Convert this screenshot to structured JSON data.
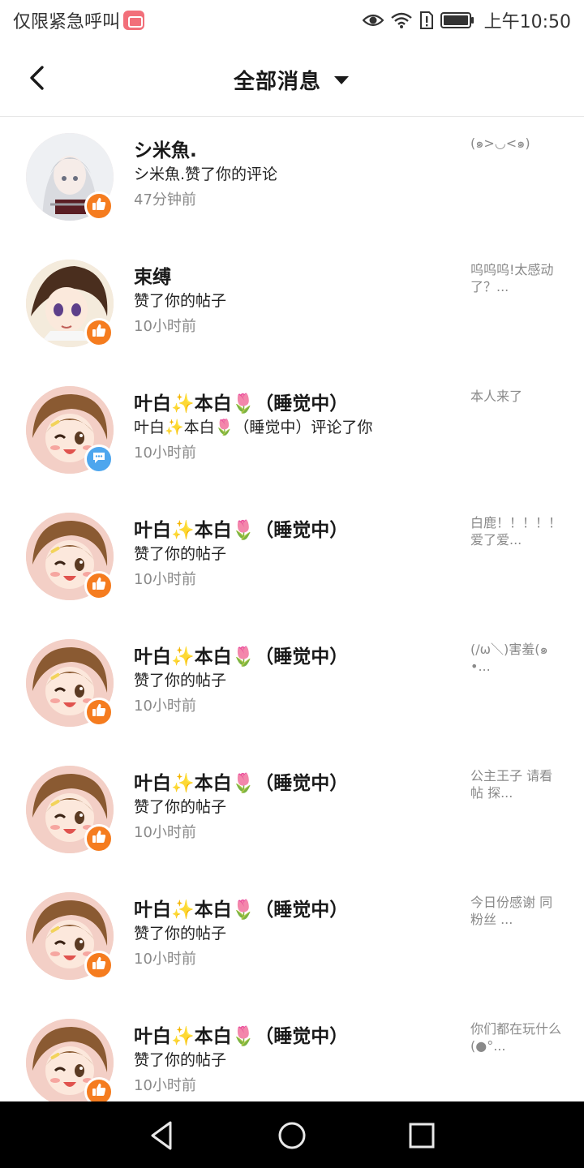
{
  "status_bar": {
    "carrier_text": "仅限紧急呼叫",
    "time": "上午10:50",
    "icons": [
      "app-notification-icon",
      "eye-icon",
      "wifi-icon",
      "sim-alert-icon",
      "battery-icon"
    ]
  },
  "header": {
    "title": "全部消息",
    "back_icon": "chevron-left-icon",
    "dropdown_icon": "caret-down-icon"
  },
  "colors": {
    "like_badge": "#f57c1f",
    "comment_badge": "#4da6ee",
    "secondary_text": "#8a8a8a"
  },
  "messages": [
    {
      "name": "シ米魚.",
      "action": "シ米魚.赞了你的评论",
      "time": "47分钟前",
      "preview": "(๑>◡<๑)",
      "badge": "like-icon",
      "avatar": "silver-hair-avatar"
    },
    {
      "name": "束缚",
      "action": "赞了你的帖子",
      "time": "10小时前",
      "preview": "呜呜呜!太感动了？...",
      "badge": "like-icon",
      "avatar": "brown-hair-avatar"
    },
    {
      "name": "叶白✨本白🌷（睡觉中）",
      "action": "叶白✨本白🌷（睡觉中）评论了你",
      "time": "10小时前",
      "preview": "本人来了",
      "badge": "comment-icon",
      "avatar": "winking-girl-avatar"
    },
    {
      "name": "叶白✨本白🌷（睡觉中）",
      "action": "赞了你的帖子",
      "time": "10小时前",
      "preview": "白鹿！！！！！爱了爱...",
      "badge": "like-icon",
      "avatar": "winking-girl-avatar"
    },
    {
      "name": "叶白✨本白🌷（睡觉中）",
      "action": "赞了你的帖子",
      "time": "10小时前",
      "preview": "(/ω＼)害羞(๑•...",
      "badge": "like-icon",
      "avatar": "winking-girl-avatar"
    },
    {
      "name": "叶白✨本白🌷（睡觉中）",
      "action": "赞了你的帖子",
      "time": "10小时前",
      "preview": "公主王子 请看帖 探...",
      "badge": "like-icon",
      "avatar": "winking-girl-avatar"
    },
    {
      "name": "叶白✨本白🌷（睡觉中）",
      "action": "赞了你的帖子",
      "time": "10小时前",
      "preview": "今日份感谢 同粉丝 ...",
      "badge": "like-icon",
      "avatar": "winking-girl-avatar"
    },
    {
      "name": "叶白✨本白🌷（睡觉中）",
      "action": "赞了你的帖子",
      "time": "10小时前",
      "preview": "你们都在玩什么(●°...",
      "badge": "like-icon",
      "avatar": "winking-girl-avatar"
    }
  ],
  "nav_bar": {
    "buttons": [
      "back-triangle-icon",
      "home-circle-icon",
      "recents-square-icon"
    ]
  }
}
